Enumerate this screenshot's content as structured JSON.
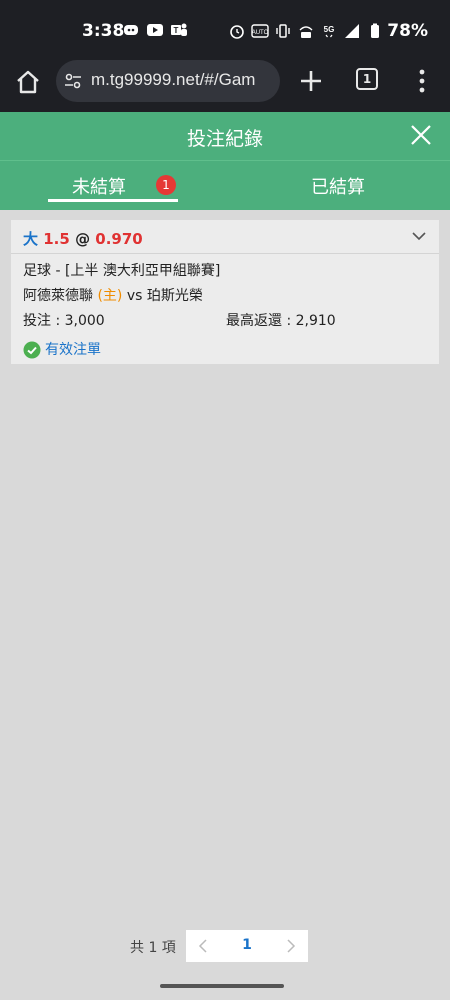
{
  "status": {
    "time": "3:38",
    "battery": "78%",
    "left_icons": [
      "discord-icon",
      "youtube-icon",
      "teams-icon"
    ],
    "right_icons": [
      "alarm-icon",
      "auto-icon",
      "vibrate-icon",
      "volte-icon",
      "5g-icon",
      "signal-icon",
      "battery-icon"
    ]
  },
  "browser": {
    "url": "m.tg99999.net/#/Gam",
    "tab_count": "1"
  },
  "header": {
    "title": "投注紀錄"
  },
  "tabs": {
    "unsettled_label": "未結算",
    "unsettled_badge": "1",
    "settled_label": "已結算"
  },
  "bet": {
    "selection": "大",
    "line": "1.5",
    "at": "@",
    "odds": "0.970",
    "league": "足球 - [上半 澳大利亞甲組聯賽]",
    "home_team": "阿德萊德聯",
    "home_tag": "(主)",
    "vs": "vs",
    "away_team": "珀斯光榮",
    "stake_label": "投注 : 3,000",
    "return_label": "最高返還 : 2,910",
    "status": "有效注單"
  },
  "pager": {
    "total": "共 1 項",
    "current": "1"
  },
  "colors": {
    "header_green": "#4caf7d",
    "blue": "#1a73c9",
    "red": "#e03232",
    "orange": "#f08c00"
  }
}
